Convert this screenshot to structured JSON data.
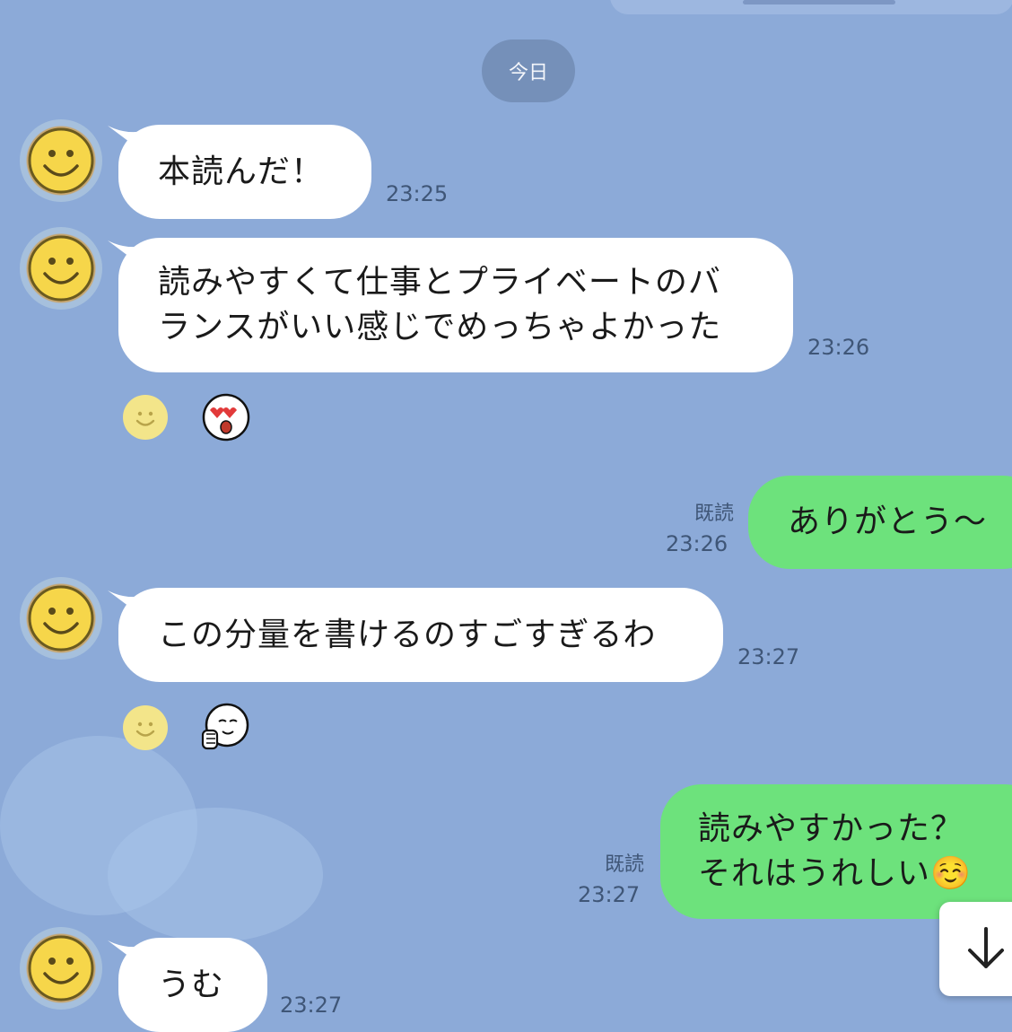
{
  "chat": {
    "date_divider": "今日",
    "messages": [
      {
        "side": "in",
        "text": "本読んだ！",
        "time": "23:25"
      },
      {
        "side": "in",
        "lines": [
          "読みやすくて仕事とプライベートのバ",
          "ランスがいい感じでめっちゃよかった"
        ],
        "time": "23:26",
        "reactions": [
          "smile-icon",
          "heart-eyes-sticker"
        ]
      },
      {
        "side": "out",
        "text": "ありがとう〜",
        "read": "既読",
        "time": "23:26"
      },
      {
        "side": "in",
        "text": "この分量を書けるのすごすぎるわ",
        "time": "23:27",
        "reactions": [
          "smile-icon",
          "thumbs-up-sticker"
        ]
      },
      {
        "side": "out",
        "lines": [
          "読みやすかった？",
          "それはうれしい☺️"
        ],
        "read": "既読",
        "time": "23:27"
      },
      {
        "side": "in",
        "text": "うむ",
        "time": "23:27"
      }
    ]
  },
  "scroll_button": {
    "icon": "arrow-down-icon"
  },
  "colors": {
    "background": "#8caad8",
    "incoming": "#ffffff",
    "outgoing": "#6de27c"
  }
}
